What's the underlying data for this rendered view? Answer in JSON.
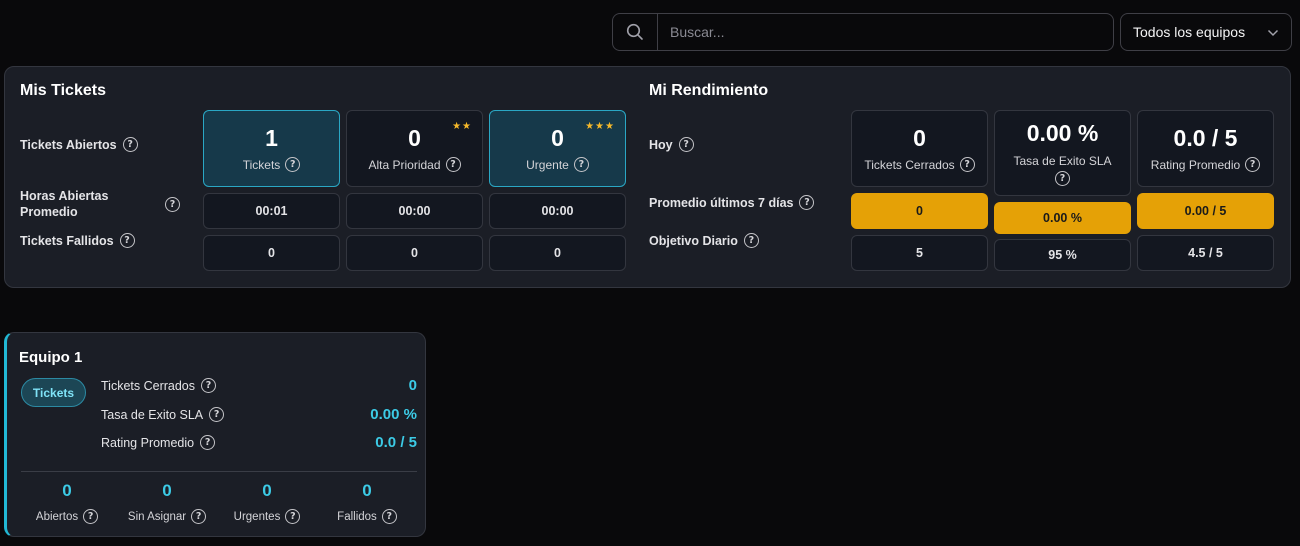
{
  "search": {
    "placeholder": "Buscar..."
  },
  "team_filter": {
    "selected": "Todos los equipos"
  },
  "mis_tickets": {
    "title": "Mis Tickets",
    "rows": {
      "open": "Tickets Abiertos",
      "hours": "Horas Abiertas Promedio",
      "failed": "Tickets Fallidos"
    },
    "cards": [
      {
        "value": "1",
        "label": "Tickets",
        "stars": ""
      },
      {
        "value": "0",
        "label": "Alta Prioridad",
        "stars": "★★"
      },
      {
        "value": "0",
        "label": "Urgente",
        "stars": "★★★"
      }
    ],
    "hours": [
      "00:01",
      "00:00",
      "00:00"
    ],
    "failed": [
      "0",
      "0",
      "0"
    ]
  },
  "rendimiento": {
    "title": "Mi Rendimiento",
    "rows": {
      "today": "Hoy",
      "avg7": "Promedio últimos 7 días",
      "goal": "Objetivo Diario"
    },
    "cards": [
      {
        "value": "0",
        "label": "Tickets Cerrados"
      },
      {
        "value": "0.00 %",
        "label": "Tasa de Exito SLA"
      },
      {
        "value": "0.0 / 5",
        "label": "Rating Promedio"
      }
    ],
    "avg7": [
      "0",
      "0.00 %",
      "0.00 / 5"
    ],
    "goal": [
      "5",
      "95 %",
      "4.5 / 5"
    ]
  },
  "team": {
    "name": "Equipo 1",
    "pill": "Tickets",
    "metrics": [
      {
        "label": "Tickets Cerrados",
        "value": "0"
      },
      {
        "label": "Tasa de Exito SLA",
        "value": "0.00 %"
      },
      {
        "label": "Rating Promedio",
        "value": "0.0 / 5"
      }
    ],
    "stats": [
      {
        "value": "0",
        "label": "Abiertos"
      },
      {
        "value": "0",
        "label": "Sin Asignar"
      },
      {
        "value": "0",
        "label": "Urgentes"
      },
      {
        "value": "0",
        "label": "Fallidos"
      }
    ]
  },
  "colors": {
    "accent": "#22b8d4",
    "gold": "#e5a106",
    "highlight": "#16394a"
  },
  "icons": {
    "search": "search-icon",
    "dropdown": "chevron-down-icon",
    "help": "help-circle-icon",
    "stars": "star-icon"
  }
}
